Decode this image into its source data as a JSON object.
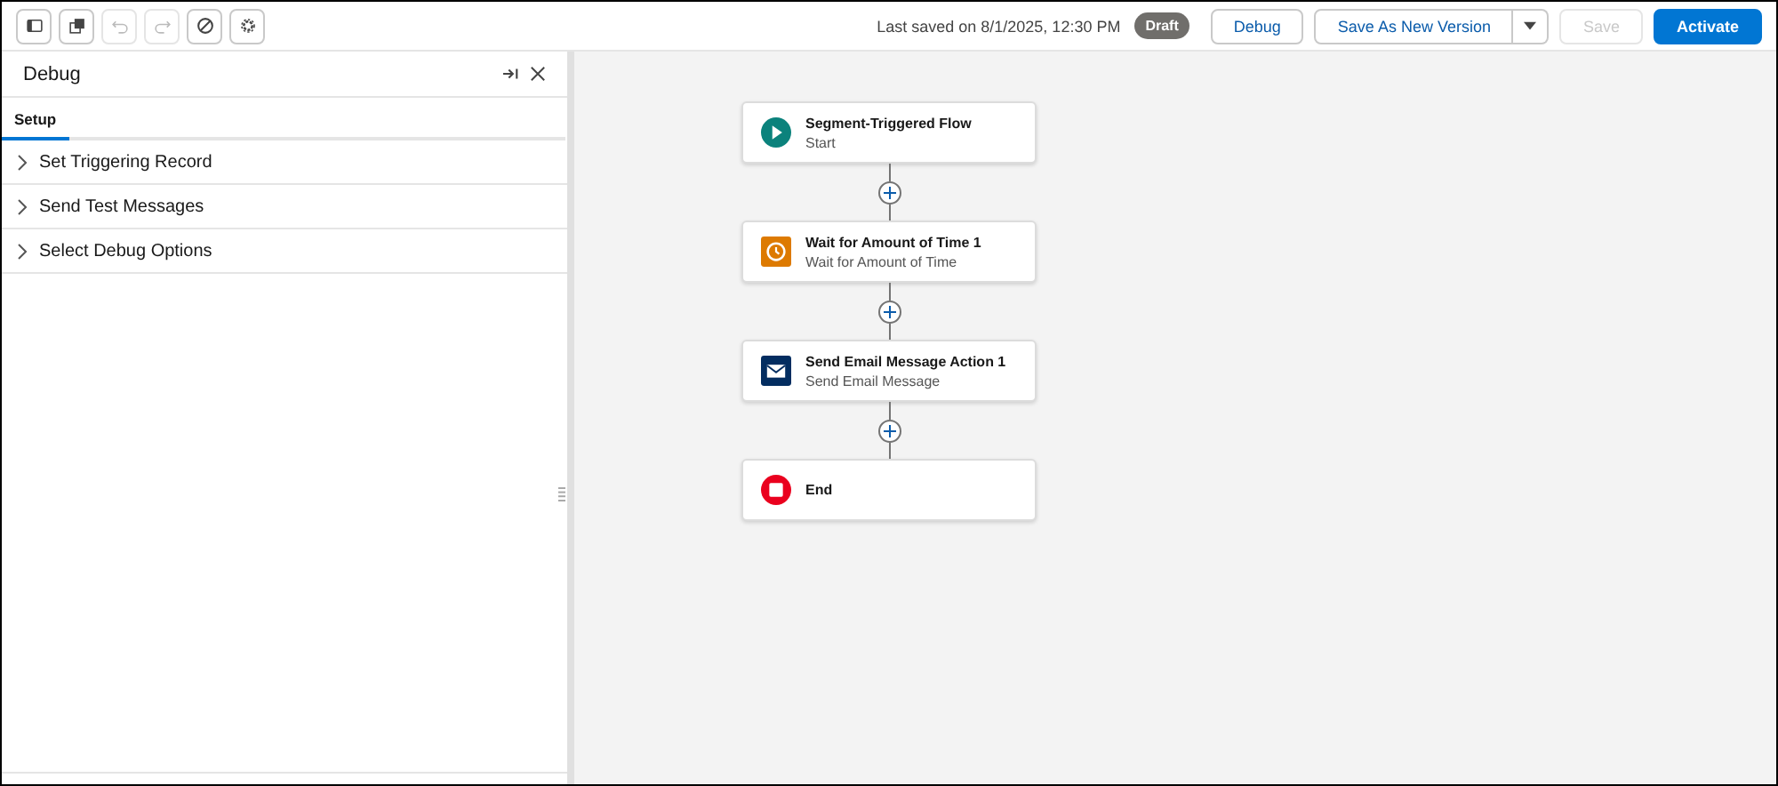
{
  "toolbar": {
    "tools": [
      {
        "kind": "panel",
        "disabled": false
      },
      {
        "kind": "copy",
        "disabled": false
      },
      {
        "kind": "undo",
        "disabled": true
      },
      {
        "kind": "redo",
        "disabled": true
      },
      {
        "kind": "block",
        "disabled": false
      },
      {
        "kind": "gear",
        "disabled": false
      }
    ],
    "last_saved": "Last saved on 8/1/2025, 12:30 PM",
    "status_badge": "Draft",
    "buttons": [
      {
        "label": "Debug",
        "kind": "neutral",
        "disabled": false
      },
      {
        "label": "Save As New Version",
        "kind": "split",
        "disabled": false
      },
      {
        "label": "Save",
        "kind": "neutral",
        "disabled": true
      },
      {
        "label": "Activate",
        "kind": "brand",
        "disabled": false
      }
    ]
  },
  "debug_panel": {
    "title": "Debug",
    "tabs": [
      {
        "label": "Setup",
        "selected": true
      }
    ],
    "sections": [
      {
        "label": "Set Triggering Record",
        "expanded": false
      },
      {
        "label": "Send Test Messages",
        "expanded": false
      },
      {
        "label": "Select Debug Options",
        "expanded": false
      }
    ]
  },
  "flow": {
    "nodes": [
      {
        "kind": "start",
        "title": "Segment-Triggered Flow",
        "subtitle": "Start"
      },
      {
        "kind": "wait",
        "title": "Wait for Amount of Time 1",
        "subtitle": "Wait for Amount of Time"
      },
      {
        "kind": "email",
        "title": "Send Email Message Action 1",
        "subtitle": "Send Email Message"
      },
      {
        "kind": "end",
        "title": "End"
      }
    ]
  }
}
